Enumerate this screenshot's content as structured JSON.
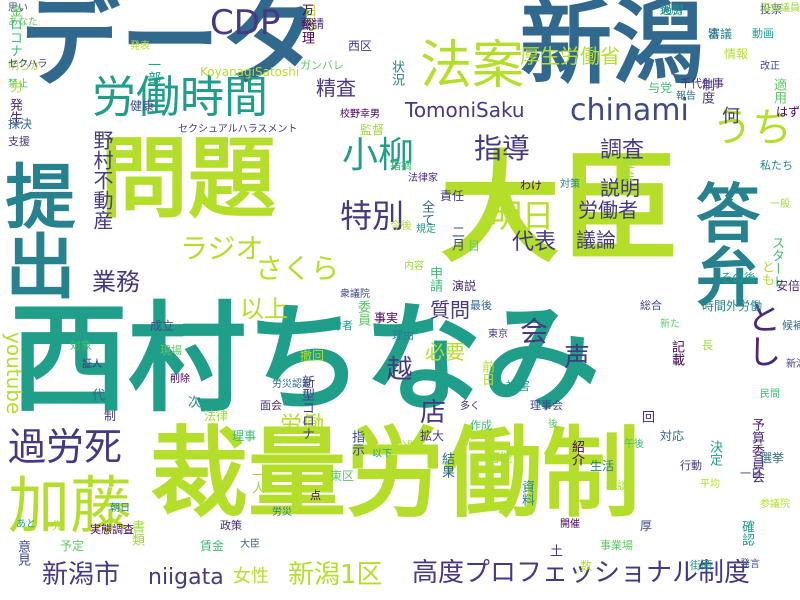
{
  "colors": {
    "lime": "#b5de2b",
    "yellowgreen": "#a0da39",
    "green": "#5ec962",
    "mint": "#3dbc74",
    "teal": "#1f9e89",
    "cyan": "#26828e",
    "blue": "#31688e",
    "indigo": "#3e4989",
    "navy": "#443983",
    "violet": "#482878",
    "purple": "#440154"
  },
  "words": {
    "daijin": "大臣",
    "nishimura_chinami": "西村ちなみ",
    "sairyo_rodo_sei": "裁量労働制",
    "data": "データ",
    "shingata": "新潟",
    "mondai": "問題",
    "teishutsu": "提出",
    "toben": "答弁",
    "cdp": "CDP",
    "rodo_jikan": "労働時間",
    "kato": "加藤",
    "hoan": "法案",
    "kourou": "過労死",
    "chinami": "chinami",
    "koyanagi": "小柳",
    "uchi": "うち",
    "tomonisaku": "TomoniSaku",
    "koudo_pro": "高度プロフェッショナル制度",
    "niigata_shi": "新潟市",
    "niigata": "niigata",
    "niigata_1ku": "新潟1区",
    "radio": "ラジオ",
    "sakura": "さくら",
    "shido": "指導",
    "tokubetsu": "特別",
    "ashita": "明日",
    "shitsumon": "質問",
    "hitsuyou": "必要",
    "rodo": "労働",
    "gyomu": "業務",
    "ijo": "以上",
    "kai": "会",
    "koe": "声",
    "josei": "女性",
    "mise": "店",
    "hyogo": "言葉",
    "youtube": "youtube",
    "kosei_rodosho": "厚生労働省",
    "seisa": "精査",
    "nomura": "野村不動産",
    "rodosha": "労働者",
    "daihyo": "代表",
    "giron": "議論",
    "setsumei": "説明",
    "chosa": "調査",
    "nani": "何",
    "koyanagi_satoshi": "KoyanagiSatoshi",
    "toshi": "とし",
    "koshi": "越",
    "gyoumu2": "業務",
    "kudo": "工藤",
    "nishiku": "西区",
    "sekuhara_long": "セクシュアルハラスメント",
    "small": [
      "思い",
      "日程",
      "過労",
      "投票",
      "あなた",
      "総理",
      "審議",
      "明らか",
      "禁止",
      "発生",
      "採決",
      "支援",
      "発表",
      "一部",
      "健康",
      "ガンバレ",
      "校野幸男",
      "状況",
      "監督",
      "指摘",
      "法律家",
      "全て",
      "責任",
      "今後",
      "規定",
      "二月",
      "目",
      "わけ",
      "対策",
      "社会",
      "与党",
      "千代仕事",
      "報告",
      "制度",
      "情報",
      "動画",
      "改正",
      "適用",
      "はず",
      "私たち",
      "一般",
      "スタート",
      "安倍総理",
      "候補",
      "新潟県",
      "とも",
      "その後",
      "総合",
      "新た",
      "記載",
      "時間外労働",
      "長",
      "民間",
      "予算委員会",
      "選挙",
      "一日",
      "参議院",
      "確認",
      "厚",
      "事業場",
      "開催",
      "資料",
      "可能",
      "作成",
      "多く",
      "結果",
      "拡大",
      "公開",
      "以下",
      "指示",
      "東区",
      "点",
      "労災",
      "一人",
      "理事",
      "面会",
      "労災認定",
      "新型コロナ",
      "撤回",
      "厚労者",
      "衆議院",
      "委員",
      "事実",
      "理由",
      "内容",
      "申請",
      "演説",
      "最後",
      "東京",
      "前日",
      "被害",
      "理事会",
      "後",
      "紹介",
      "生活",
      "相談",
      "午後",
      "回",
      "対応",
      "行動",
      "平均",
      "決定",
      "成立",
      "現場",
      "削除",
      "次",
      "法律",
      "対象",
      "証人",
      "代",
      "制",
      "先",
      "あと",
      "意見",
      "予定",
      "実態調査",
      "朝日",
      "書類",
      "賃金",
      "政策",
      "大臣",
      "土",
      "数",
      "街頭",
      "発言",
      "金",
      "万",
      "実態",
      "国会議員",
      "ロコナ",
      "要請",
      "法",
      "セクハラ",
      "労"
    ]
  }
}
